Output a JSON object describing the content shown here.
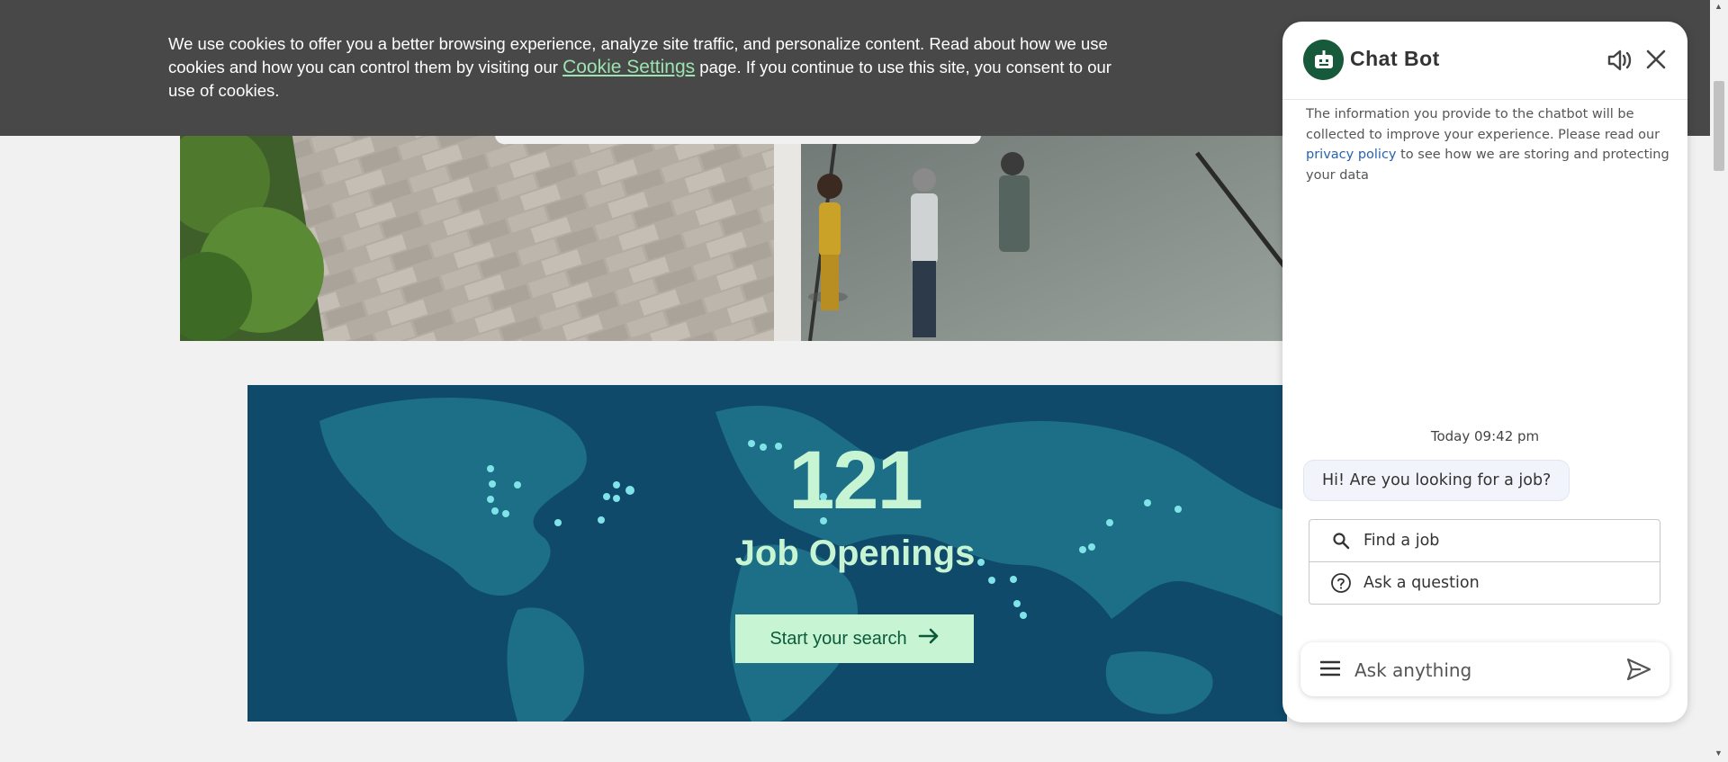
{
  "cookie_banner": {
    "text_before": "We use cookies to offer you a better browsing experience, analyze site traffic, and personalize content. Read about how we use cookies and how you can control them by visiting our ",
    "link_label": "Cookie Settings",
    "text_after": " page. If you continue to use this site, you consent to our use of cookies."
  },
  "jobs": {
    "count": "121",
    "label": "Job Openings",
    "cta_label": "Start your search",
    "colors": {
      "background": "#0f4a6b",
      "accent": "#c7f5d3"
    }
  },
  "chat": {
    "title": "Chat Bot",
    "disclaimer_before": "The information you provide to the chatbot will be collected to improve your experience. Please read our ",
    "privacy_link": "privacy policy",
    "disclaimer_after": " to see how we are storing and protecting your data",
    "timestamp": "Today 09:42 pm",
    "bot_message": "Hi! Are you looking for a job?",
    "options": [
      {
        "label": "Find a job",
        "icon": "search-icon"
      },
      {
        "label": "Ask a question",
        "icon": "question-circle-icon"
      }
    ],
    "input_placeholder": "Ask anything",
    "colors": {
      "brand": "#17593b"
    }
  }
}
